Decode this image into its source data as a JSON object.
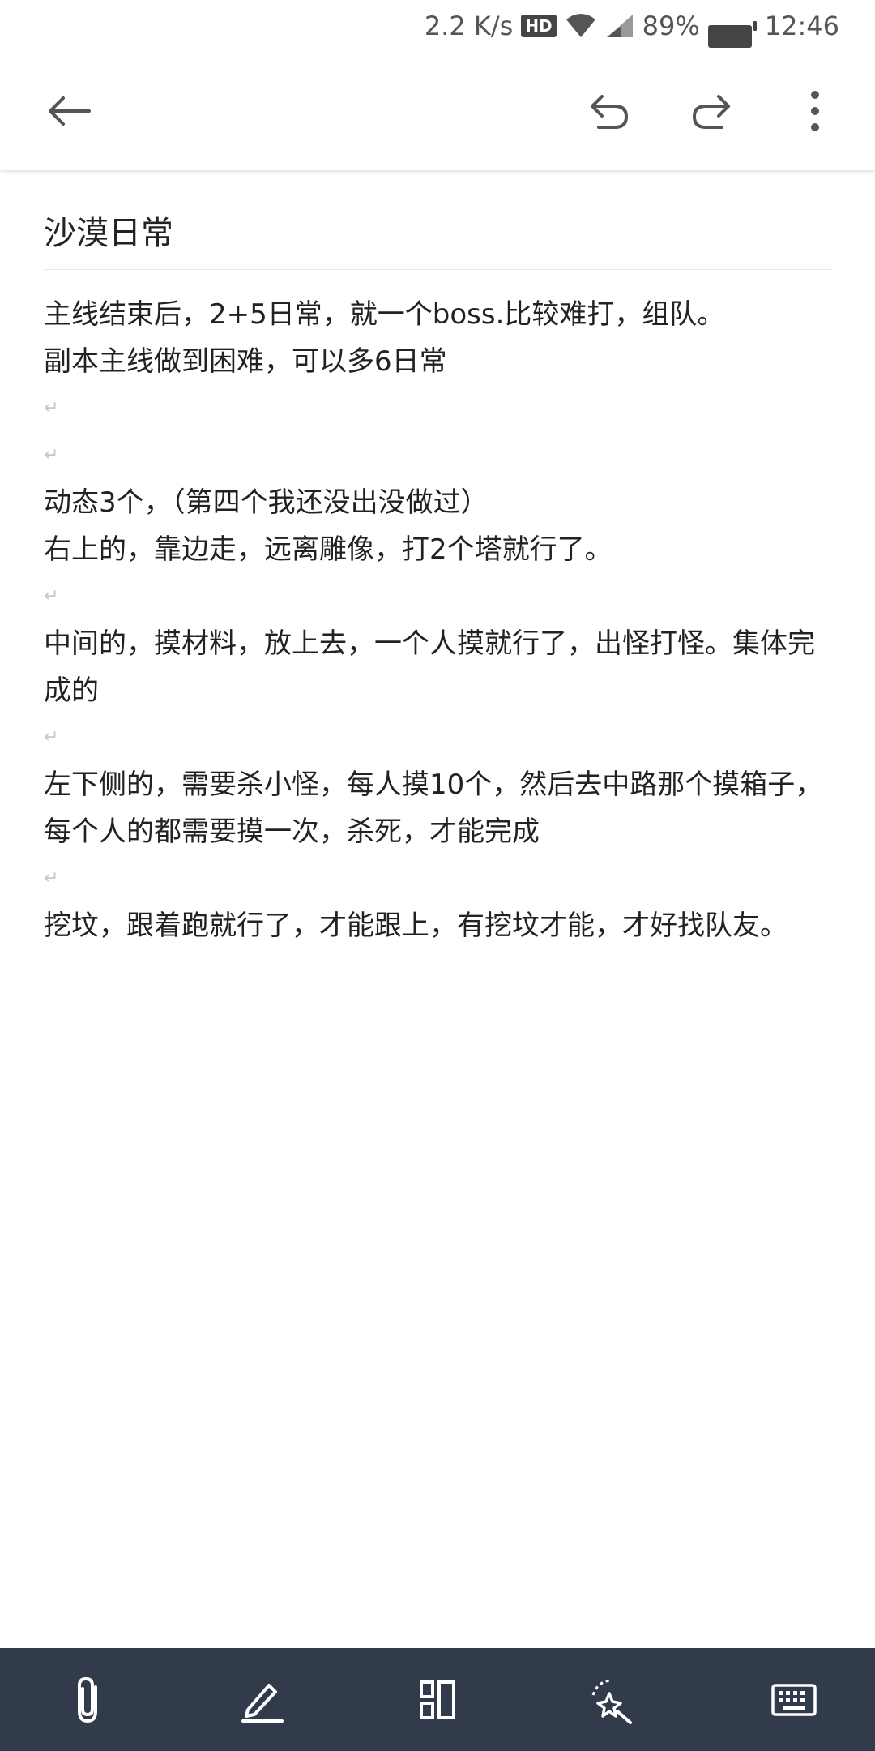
{
  "status": {
    "speed": "2.2 K/s",
    "hd": "HD",
    "battery": "89%",
    "time": "12:46"
  },
  "toolbar": {
    "icons": [
      "back-arrow-icon",
      "undo-icon",
      "redo-icon",
      "more-vertical-icon"
    ]
  },
  "note": {
    "title": "沙漠日常",
    "paragraphs": [
      "主线结束后，2+5日常，就一个boss.比较难打，组队。",
      "副本主线做到困难，可以多6日常",
      "",
      "",
      "动态3个，（第四个我还没出没做过）",
      "右上的，靠边走，远离雕像，打2个塔就行了。",
      "",
      "中间的，摸材料，放上去，一个人摸就行了，出怪打怪。集体完成的",
      "",
      "左下侧的，需要杀小怪，每人摸10个，然后去中路那个摸箱子，每个人的都需要摸一次，杀死，才能完成",
      "",
      "挖坟，跟着跑就行了，才能跟上，有挖坟才能，才好找队友。"
    ],
    "return_mark": "↵"
  },
  "bottombar": {
    "icons": [
      "attachment-icon",
      "pen-icon",
      "layout-icon",
      "magic-wand-icon",
      "keyboard-icon"
    ]
  },
  "colors": {
    "bottombar_bg": "#323b4b",
    "icon_light": "#ffffff",
    "icon_dark": "#555555"
  }
}
